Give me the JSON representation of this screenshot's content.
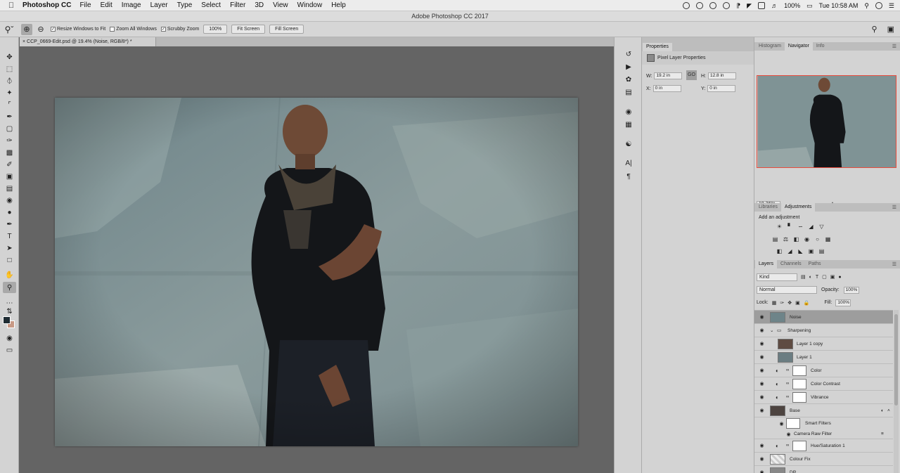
{
  "menubar": {
    "app_name": "Photoshop CC",
    "items": [
      "File",
      "Edit",
      "Image",
      "Layer",
      "Type",
      "Select",
      "Filter",
      "3D",
      "View",
      "Window",
      "Help"
    ],
    "battery": "100%",
    "clock": "Tue 10:58 AM"
  },
  "window_title": "Adobe Photoshop CC 2017",
  "options": {
    "resize_windows": "Resize Windows to Fit",
    "zoom_all": "Zoom All Windows",
    "scrubby": "Scrubby Zoom",
    "zoom_100": "100%",
    "fit_screen": "Fit Screen",
    "fill_screen": "Fill Screen"
  },
  "document_tab": "CCP_0669-Edit.psd @ 19.4% (Noise, RGB/8*) *",
  "properties": {
    "tab": "Properties",
    "header": "Pixel Layer Properties",
    "w_label": "W:",
    "w_value": "19.2 in",
    "h_label": "H:",
    "h_value": "12.8 in",
    "x_label": "X:",
    "x_value": "0 in",
    "y_label": "Y:",
    "y_value": "0 in",
    "link_label": "GO"
  },
  "navigator": {
    "tabs": [
      "Histogram",
      "Navigator",
      "Info"
    ],
    "zoom": "19.36%"
  },
  "adjustments": {
    "tabs": [
      "Libraries",
      "Adjustments"
    ],
    "title": "Add an adjustment"
  },
  "layers_panel": {
    "tabs": [
      "Layers",
      "Channels",
      "Paths"
    ],
    "kind": "Kind",
    "blend_mode": "Normal",
    "opacity_label": "Opacity:",
    "opacity": "100%",
    "lock_label": "Lock:",
    "fill_label": "Fill:",
    "fill": "100%",
    "layers": [
      {
        "name": "Noise"
      },
      {
        "name": "Sharpening"
      },
      {
        "name": "Layer 1 copy"
      },
      {
        "name": "Layer 1"
      },
      {
        "name": "Color"
      },
      {
        "name": "Color Contrast"
      },
      {
        "name": "Vibrance"
      },
      {
        "name": "Base"
      },
      {
        "name": "Smart Filters"
      },
      {
        "name": "Camera Raw Filter"
      },
      {
        "name": "Hue/Saturation 1"
      },
      {
        "name": "Colour Fix"
      },
      {
        "name": "DR"
      }
    ]
  },
  "colors": {
    "foreground": "#1f2c33",
    "background": "#c89a86",
    "navigator_frame": "#e84c3d"
  }
}
